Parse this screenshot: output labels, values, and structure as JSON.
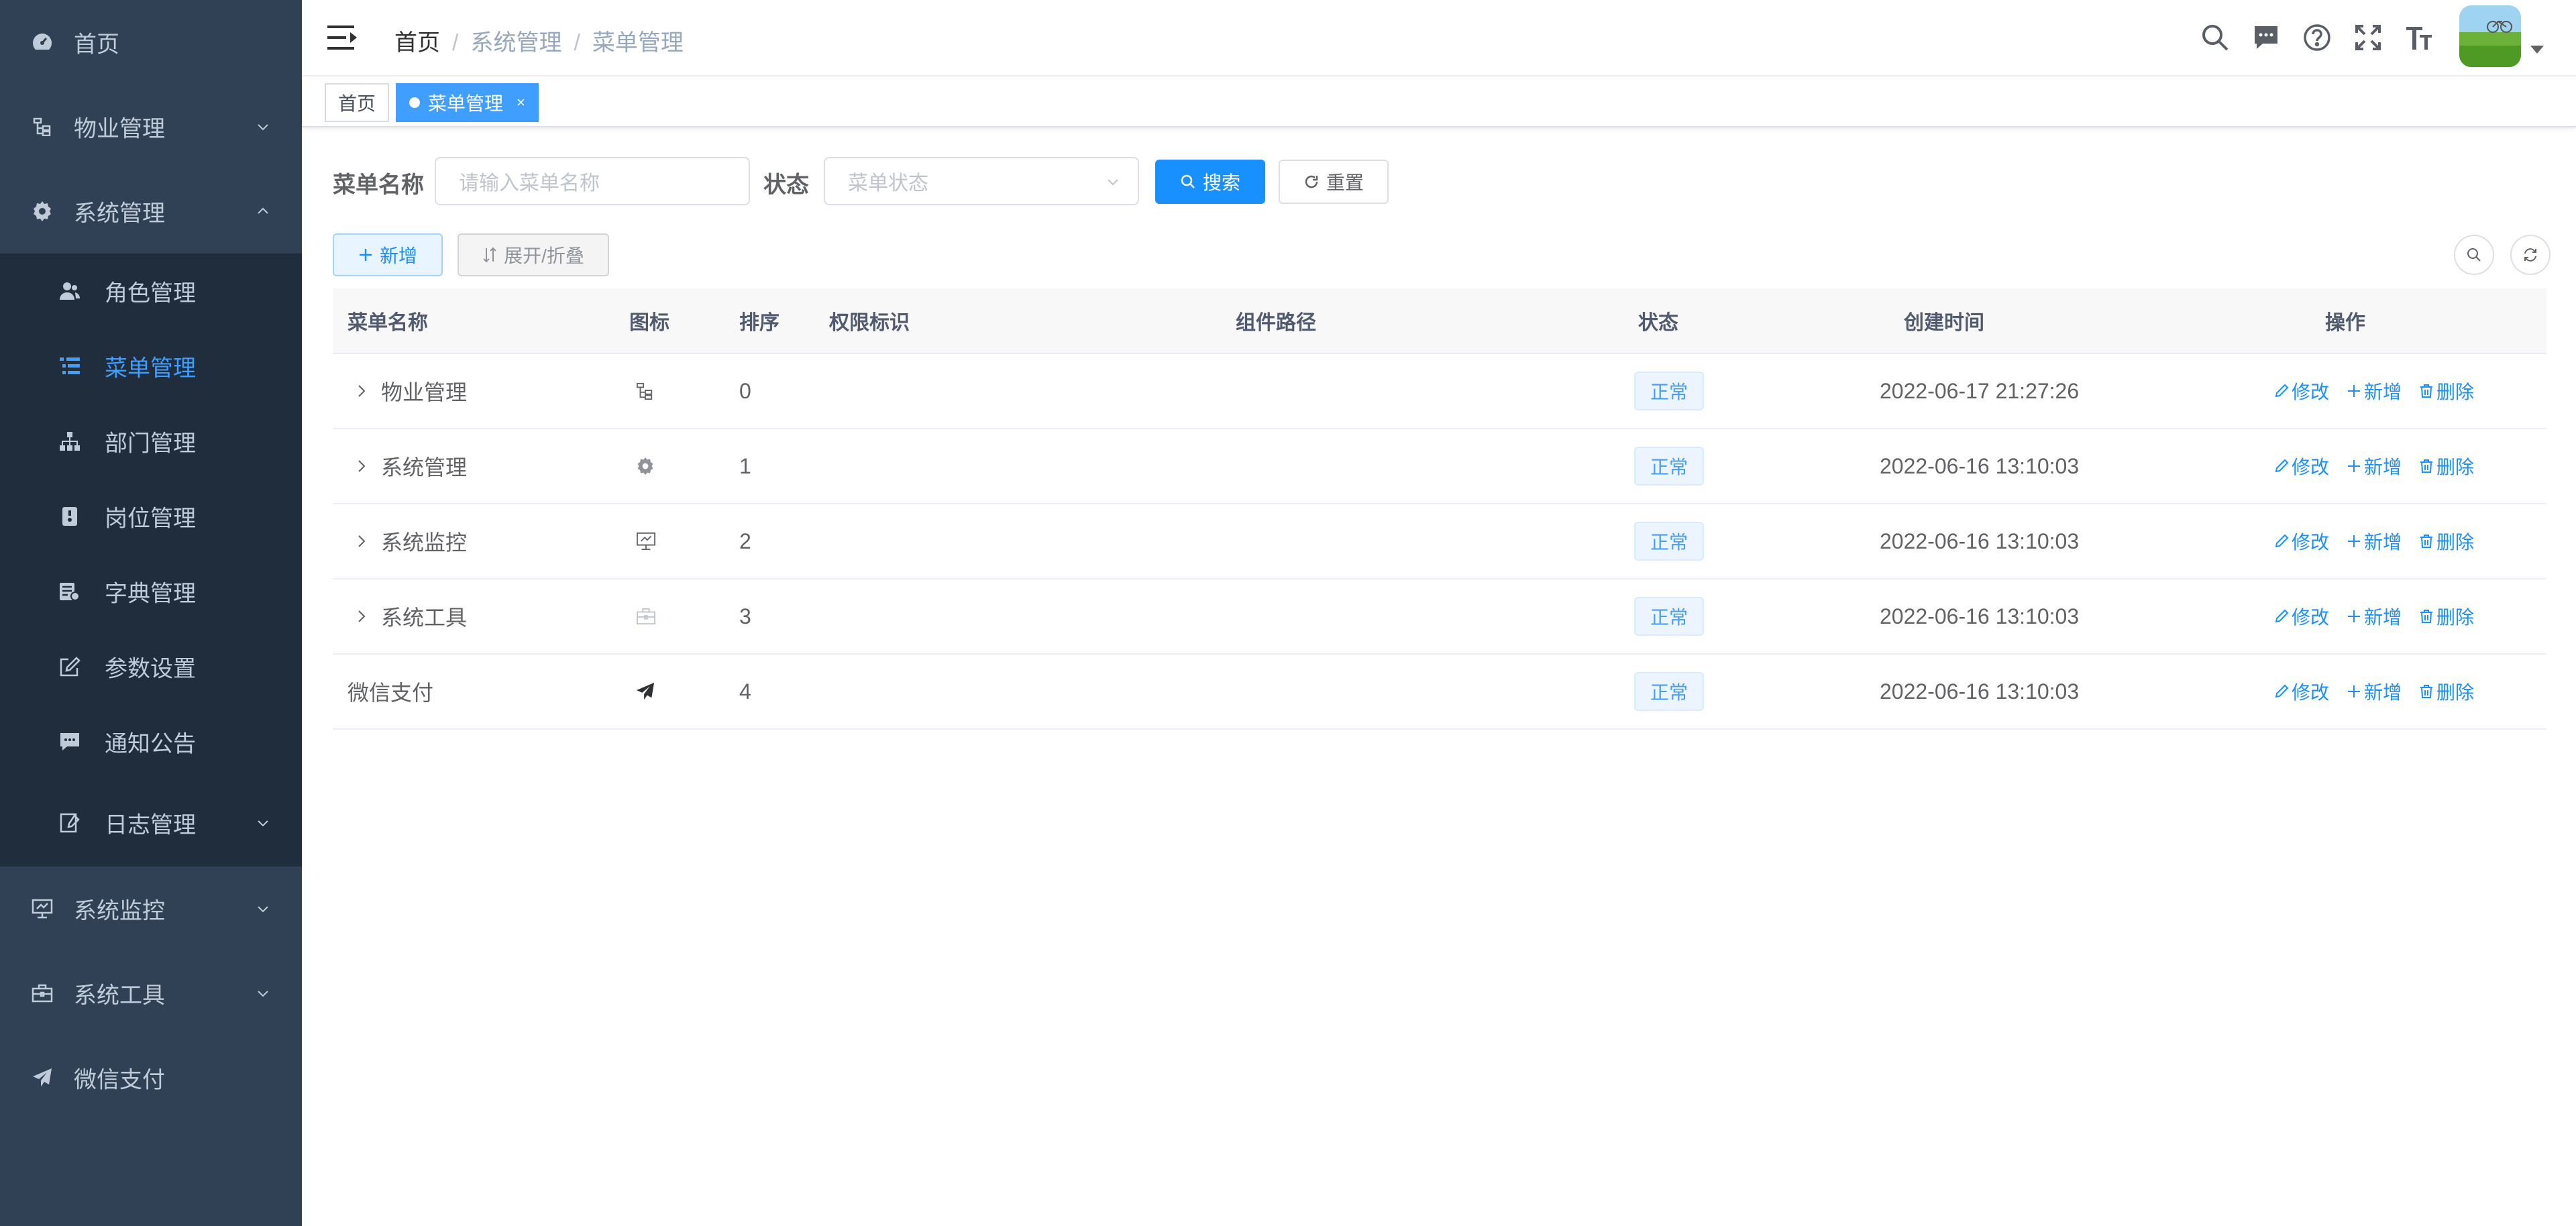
{
  "sidebar": {
    "items": [
      {
        "label": "首页",
        "icon": "dashboard-icon"
      },
      {
        "label": "物业管理",
        "icon": "tree-icon"
      },
      {
        "label": "系统管理",
        "icon": "gear-icon"
      },
      {
        "label": "系统监控",
        "icon": "monitor-icon"
      },
      {
        "label": "系统工具",
        "icon": "toolbox-icon"
      },
      {
        "label": "微信支付",
        "icon": "paper-plane-icon"
      }
    ],
    "subitems": [
      {
        "label": "角色管理",
        "icon": "peoples-icon"
      },
      {
        "label": "菜单管理",
        "icon": "tree-table-icon"
      },
      {
        "label": "部门管理",
        "icon": "org-tree-icon"
      },
      {
        "label": "岗位管理",
        "icon": "post-icon"
      },
      {
        "label": "字典管理",
        "icon": "dict-icon"
      },
      {
        "label": "参数设置",
        "icon": "edit-icon"
      },
      {
        "label": "通知公告",
        "icon": "message-icon"
      },
      {
        "label": "日志管理",
        "icon": "log-icon"
      }
    ]
  },
  "header": {
    "breadcrumb": [
      "首页",
      "系统管理",
      "菜单管理"
    ],
    "breadcrumb_sep": "/"
  },
  "tags": [
    {
      "label": "首页"
    },
    {
      "label": "菜单管理",
      "close": "×"
    }
  ],
  "search": {
    "name_label": "菜单名称",
    "name_placeholder": "请输入菜单名称",
    "status_label": "状态",
    "status_placeholder": "菜单状态",
    "search_button": "搜索",
    "reset_button": "重置"
  },
  "toolbar": {
    "add_button": "新增",
    "expand_button": "展开/折叠"
  },
  "table": {
    "columns": [
      "菜单名称",
      "图标",
      "排序",
      "权限标识",
      "组件路径",
      "状态",
      "创建时间",
      "操作"
    ],
    "rows": [
      {
        "name": "物业管理",
        "icon": "tree-icon",
        "order": "0",
        "perms": "",
        "component": "",
        "status": "正常",
        "created": "2022-06-17 21:27:26",
        "expandable": true
      },
      {
        "name": "系统管理",
        "icon": "gear-icon",
        "order": "1",
        "perms": "",
        "component": "",
        "status": "正常",
        "created": "2022-06-16 13:10:03",
        "expandable": true
      },
      {
        "name": "系统监控",
        "icon": "monitor-icon",
        "order": "2",
        "perms": "",
        "component": "",
        "status": "正常",
        "created": "2022-06-16 13:10:03",
        "expandable": true
      },
      {
        "name": "系统工具",
        "icon": "toolbox-icon",
        "order": "3",
        "perms": "",
        "component": "",
        "status": "正常",
        "created": "2022-06-16 13:10:03",
        "expandable": true
      },
      {
        "name": "微信支付",
        "icon": "paper-plane-icon",
        "order": "4",
        "perms": "",
        "component": "",
        "status": "正常",
        "created": "2022-06-16 13:10:03",
        "expandable": false
      }
    ],
    "actions": {
      "edit": "修改",
      "add": "新增",
      "delete": "删除"
    }
  },
  "colors": {
    "sidebar_bg": "#304156",
    "submenu_bg": "#1f2d3d",
    "sidebar_text": "#bfcbd9",
    "accent": "#409eff",
    "primary": "#1890ff"
  }
}
